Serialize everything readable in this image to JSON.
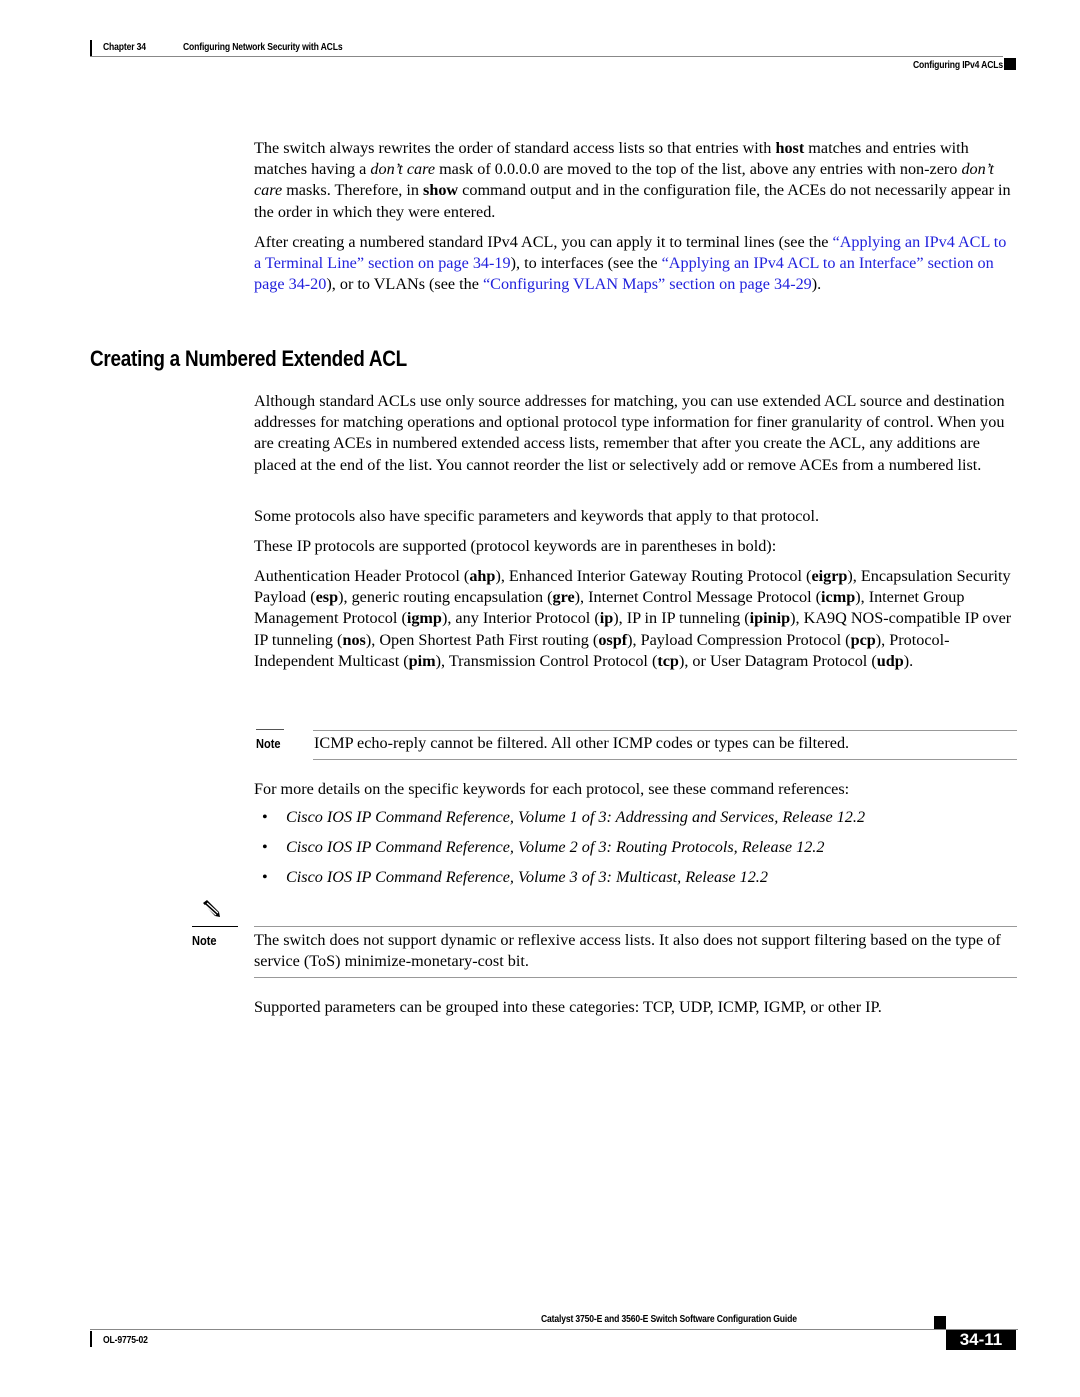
{
  "header": {
    "chapter_label": "Chapter 34",
    "chapter_title": "Configuring Network Security with ACLs",
    "section_title": "Configuring IPv4 ACLs"
  },
  "intro": {
    "para1": {
      "t1": "The switch always rewrites the order of standard access lists so that entries with ",
      "b1": "host",
      "t2": " matches and entries with matches having a ",
      "i1": "don’t care",
      "t3": " mask of 0.0.0.0 are moved to the top of the list, above any entries with non-zero ",
      "i2": "don’t care",
      "t4": " masks. Therefore, in ",
      "b2": "show",
      "t5": " command output and in the configuration file, the ACEs do not necessarily appear in the order in which they were entered."
    },
    "para2": {
      "t1": "After creating a numbered standard IPv4 ACL, you can apply it to terminal lines (see the ",
      "link1": "“Applying an IPv4 ACL to a Terminal Line” section on page 34-19",
      "t2": "), to interfaces (see the ",
      "link2": "“Applying an IPv4 ACL to an Interface” section on page 34-20",
      "t3": "), or to VLANs (see the ",
      "link3": "“Configuring VLAN Maps” section on page 34-29",
      "t4": ")."
    }
  },
  "section": {
    "heading": "Creating a Numbered Extended ACL",
    "para1": "Although standard ACLs use only source addresses for matching, you can use extended ACL source and destination addresses for matching operations and optional protocol type information for finer granularity of control. When you are creating ACEs in numbered extended access lists, remember that after you create the ACL, any additions are placed at the end of the list. You cannot reorder the list or selectively add or remove ACEs from a numbered list.",
    "para2": "Some protocols also have specific parameters and keywords that apply to that protocol.",
    "para3": "These IP protocols are supported (protocol keywords are in parentheses in bold):",
    "protocols": [
      {
        "name": "Authentication Header Protocol",
        "keyword": "ahp",
        "sep": ", "
      },
      {
        "name": "Enhanced Interior Gateway Routing Protocol",
        "keyword": "eigrp",
        "sep": ", "
      },
      {
        "name": "Encapsulation Security Payload",
        "keyword": "esp",
        "sep": ", "
      },
      {
        "name": "generic routing encapsulation",
        "keyword": "gre",
        "sep": ", "
      },
      {
        "name": "Internet Control Message Protocol",
        "keyword": "icmp",
        "sep": ", "
      },
      {
        "name": "Internet Group Management Protocol",
        "keyword": "igmp",
        "sep": ", "
      },
      {
        "name": "any Interior Protocol",
        "keyword": "ip",
        "sep": ", "
      },
      {
        "name": "IP in IP tunneling",
        "keyword": "ipinip",
        "sep": ", "
      },
      {
        "name": "KA9Q NOS-compatible IP over IP tunneling",
        "keyword": "nos",
        "sep": ", "
      },
      {
        "name": "Open Shortest Path First routing",
        "keyword": "ospf",
        "sep": ", "
      },
      {
        "name": "Payload Compression Protocol",
        "keyword": "pcp",
        "sep": ", "
      },
      {
        "name": "Protocol-Independent Multicast",
        "keyword": "pim",
        "sep": ", "
      },
      {
        "name": "Transmission Control Protocol",
        "keyword": "tcp",
        "sep": ", or "
      },
      {
        "name": "User Datagram Protocol",
        "keyword": "udp",
        "sep": "."
      }
    ],
    "note1": {
      "label": "Note",
      "text": "ICMP echo-reply cannot be filtered. All other ICMP codes or types can be filtered."
    },
    "para4": "For more details on the specific keywords for each protocol, see these command references:",
    "references": [
      "Cisco IOS IP Command Reference, Volume 1 of 3: Addressing and Services, Release 12.2",
      "Cisco IOS IP Command Reference, Volume 2 of 3: Routing Protocols, Release 12.2",
      "Cisco IOS IP Command Reference, Volume 3 of 3: Multicast, Release 12.2"
    ],
    "bullet_char": "•",
    "note2": {
      "label": "Note",
      "text": "The switch does not support dynamic or reflexive access lists. It also does not support filtering based on the type of service (ToS) minimize-monetary-cost bit."
    },
    "para5": "Supported parameters can be grouped into these categories: TCP, UDP, ICMP, IGMP, or other IP."
  },
  "footer": {
    "guide_title": "Catalyst 3750-E and 3560-E Switch Software Configuration Guide",
    "doc_number": "OL-9775-02",
    "page_number": "34-11"
  }
}
